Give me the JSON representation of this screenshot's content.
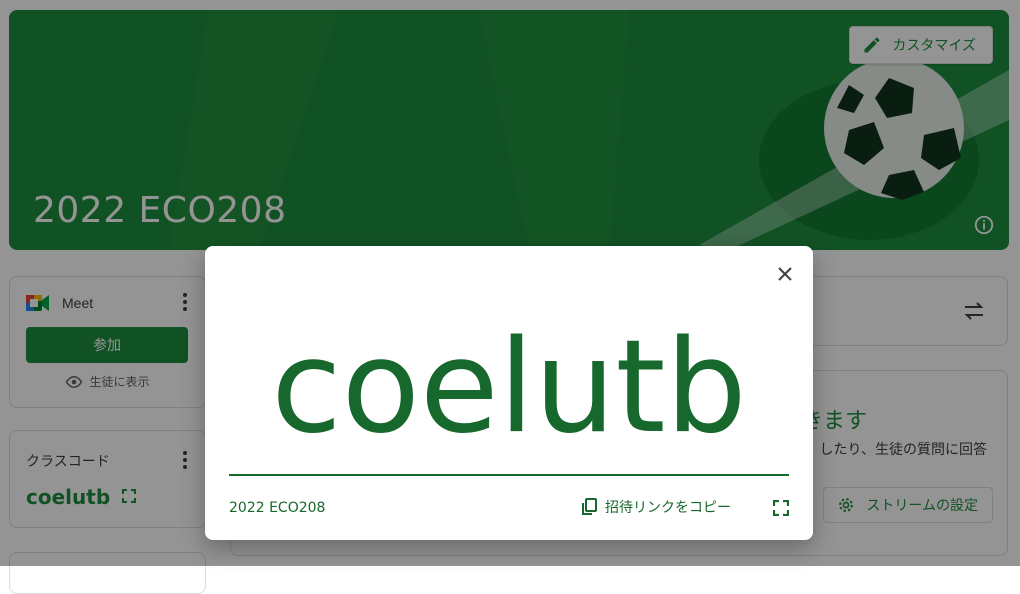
{
  "banner": {
    "title": "2022 ECO208",
    "customize_label": "カスタマイズ"
  },
  "meet": {
    "title": "Meet",
    "join_label": "参加",
    "show_students_label": "生徒に表示"
  },
  "class_code": {
    "label": "クラスコード",
    "code": "coelutb"
  },
  "stream": {
    "heading": "きます",
    "description": "したり、生徒の質問に回答",
    "settings_label": "ストリームの設定"
  },
  "dialog": {
    "code": "coelutb",
    "class_name": "2022 ECO208",
    "copy_invite_label": "招待リンクをコピー"
  },
  "colors": {
    "brand_green": "#1e8e3e",
    "dark_green": "#17682c"
  },
  "icons": [
    "pencil-icon",
    "info-icon",
    "more-vert-icon",
    "eye-icon",
    "fullscreen-icon",
    "swap-icon",
    "gear-icon",
    "close-icon",
    "copy-icon",
    "google-meet-logo"
  ]
}
